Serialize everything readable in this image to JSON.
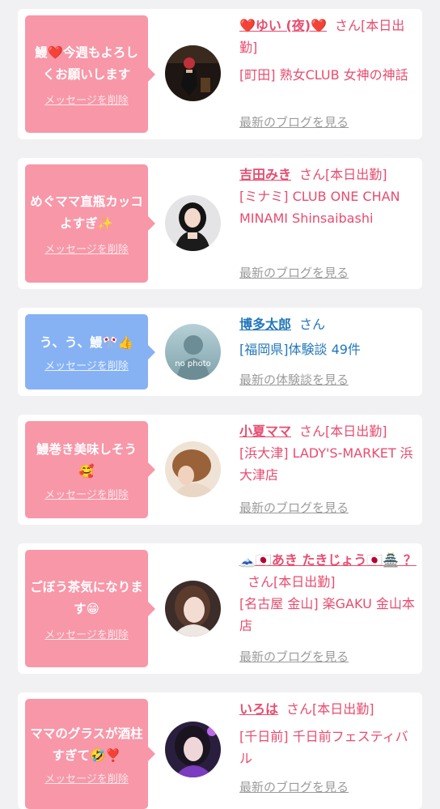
{
  "colors": {
    "accent_pink": "#f797a8",
    "accent_blue": "#86b2f4",
    "link_pink": "#e84c6f",
    "link_blue": "#2277bb",
    "muted": "#9b9b9b"
  },
  "cards": [
    {
      "message": "鰻❤️今週もよろしくお願いします",
      "delete_label": "メッセージを削除",
      "name": "❤️ゆい (夜)❤️",
      "san": "さん[本日出勤]",
      "shop": "[町田] 熟女CLUB 女神の神話",
      "link": "最新のブログを見る"
    },
    {
      "message": "めぐママ直瓶カッコよすぎ✨",
      "delete_label": "メッセージを削除",
      "name": "吉田みき",
      "san": "さん[本日出勤]",
      "shop": "[ミナミ] CLUB ONE CHAN MINAMI Shinsaibashi",
      "link": "最新のブログを見る"
    },
    {
      "message": "う、う、鰻🎌👍",
      "delete_label": "メッセージを削除",
      "name": "博多太郎",
      "san": "さん",
      "shop": "[福岡県]体験談 49件",
      "link": "最新の体験談を見る",
      "avatar_text": "no photo"
    },
    {
      "message": "鰻巻き美味しそう🥰",
      "delete_label": "メッセージを削除",
      "name": "小夏ママ",
      "san": "さん[本日出勤]",
      "shop": "[浜大津] LADY'S-MARKET 浜大津店",
      "link": "最新のブログを見る"
    },
    {
      "message": "ごぼう茶気になります😁",
      "delete_label": "メッセージを削除",
      "name": "🗻🇯🇵あき たきじょう🇯🇵🏯 ？",
      "san": "さん[本日出勤]",
      "shop": "[名古屋 金山] 楽GAKU 金山本店",
      "link": "最新のブログを見る"
    },
    {
      "message": "ママのグラスが酒柱すぎて🤣❣️",
      "delete_label": "メッセージを削除",
      "name": "いろは",
      "san": "さん[本日出勤]",
      "shop": "[千日前] 千日前フェスティバル",
      "link": "最新のブログを見る"
    }
  ]
}
